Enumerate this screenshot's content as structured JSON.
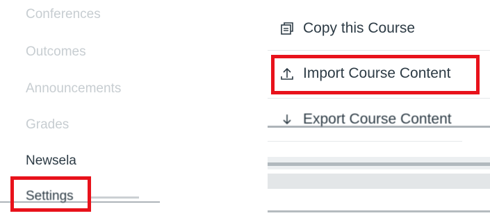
{
  "sidebar": {
    "items": [
      {
        "label": "Conferences"
      },
      {
        "label": "Outcomes"
      },
      {
        "label": "Announcements"
      },
      {
        "label": "Grades"
      },
      {
        "label": "Newsela"
      },
      {
        "label": "Settings"
      }
    ]
  },
  "actions": {
    "items": [
      {
        "label": "Copy this Course",
        "icon": "copy-icon"
      },
      {
        "label": "Import Course Content",
        "icon": "upload-icon"
      },
      {
        "label": "Export Course Content",
        "icon": "download-icon"
      }
    ]
  },
  "colors": {
    "highlight": "#e8121b",
    "muted_text": "#c7cdd1",
    "dark_text": "#2d3b45"
  }
}
